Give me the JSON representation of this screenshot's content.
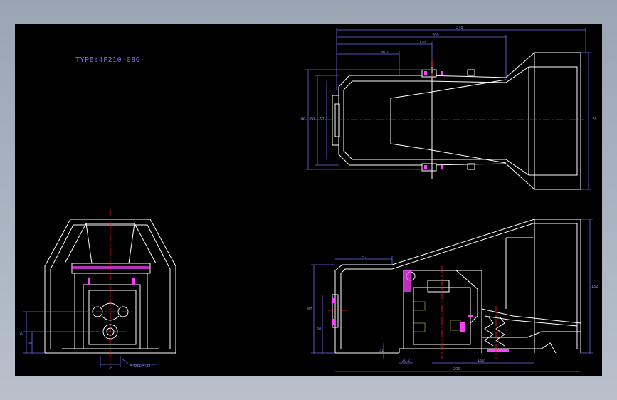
{
  "drawing": {
    "title": "TYPE:4F210-08G",
    "dimensions": {
      "top_240": "240",
      "top_200": "200",
      "top_170": "170",
      "top_86": "86.7",
      "left_90": "90",
      "left_80": "80",
      "left_60": "60",
      "right_130": "130",
      "front_25": "25",
      "front_note": "4-Ø11/4-35",
      "front_50": "50",
      "front_70": "70",
      "side_52": "52",
      "side_87": "87",
      "side_60": "60",
      "side_31": "31",
      "side_202": "20.2",
      "side_160": "160",
      "side_200": "200",
      "side_152": "152"
    },
    "colors": {
      "background": "#000000",
      "outline": "#ffffff",
      "dimension": "#6f6ff2",
      "centerline": "#ff2020",
      "section": "#ff40ff",
      "hatch": "#ffff40",
      "frame": "#b8c0cc"
    }
  }
}
